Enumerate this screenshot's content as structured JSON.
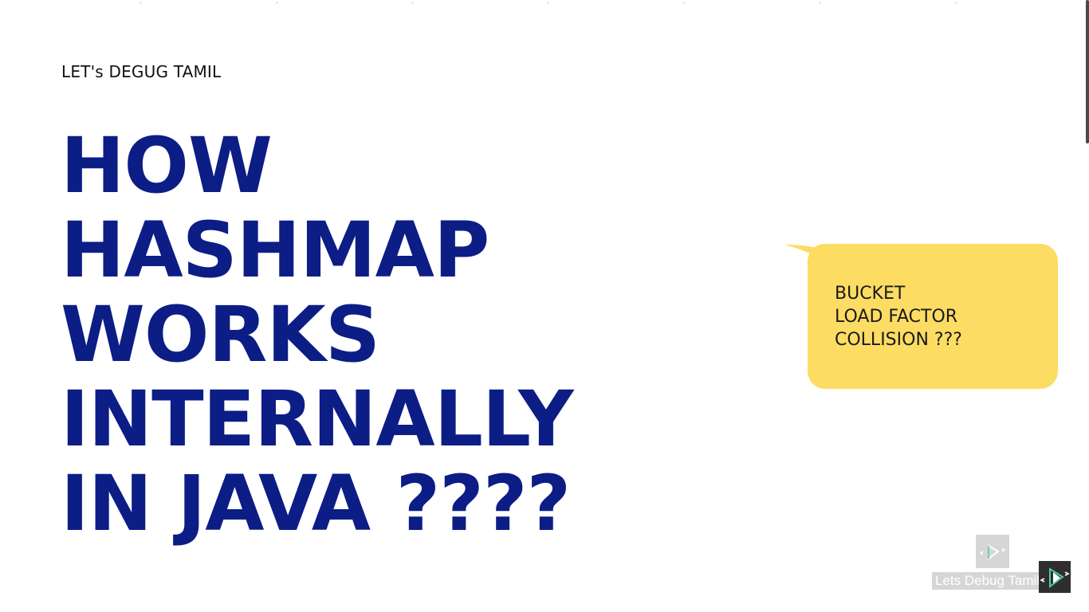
{
  "brand": "LET's DEGUG TAMIL",
  "headline": {
    "lines": [
      "HOW",
      "HASHMAP",
      "WORKS",
      "INTERNALLY",
      "IN JAVA ????"
    ]
  },
  "bubble": {
    "lines": [
      "BUCKET",
      "LOAD FACTOR",
      "COLLISION ???"
    ]
  },
  "watermark": {
    "label": "Lets Debug Tamil",
    "icon": "play-logo-icon"
  },
  "colors": {
    "headline": "#0c1d86",
    "bubble": "#fddc63",
    "background": "#ffffff"
  }
}
